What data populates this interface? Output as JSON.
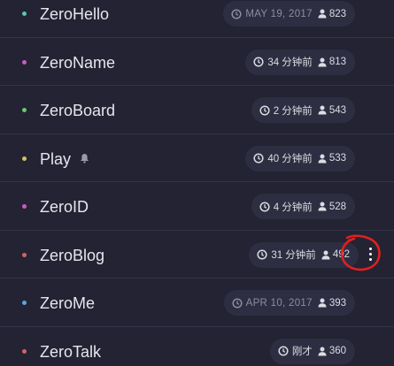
{
  "sites": [
    {
      "name": "ZeroHello",
      "dot_color": "#5ec6a8",
      "updated": "MAY 19, 2017",
      "updated_style": "date",
      "peers": "823"
    },
    {
      "name": "ZeroName",
      "dot_color": "#c85bc8",
      "updated": "34 分钟前",
      "updated_style": "relative",
      "peers": "813"
    },
    {
      "name": "ZeroBoard",
      "dot_color": "#6cc86c",
      "updated": "2 分钟前",
      "updated_style": "relative",
      "peers": "543"
    },
    {
      "name": "Play",
      "dot_color": "#d8c060",
      "updated": "40 分钟前",
      "updated_style": "relative",
      "peers": "533",
      "icon": "bell-icon"
    },
    {
      "name": "ZeroID",
      "dot_color": "#c85bc8",
      "updated": "4 分钟前",
      "updated_style": "relative",
      "peers": "528"
    },
    {
      "name": "ZeroBlog",
      "dot_color": "#d86060",
      "updated": "31 分钟前",
      "updated_style": "relative",
      "peers": "492",
      "menu": true
    },
    {
      "name": "ZeroMe",
      "dot_color": "#5aa8d8",
      "updated": "APR 10, 2017",
      "updated_style": "date",
      "peers": "393"
    },
    {
      "name": "ZeroTalk",
      "dot_color": "#d86060",
      "updated": "刚才",
      "updated_style": "relative",
      "peers": "360"
    }
  ],
  "annotation_color": "#e02020"
}
